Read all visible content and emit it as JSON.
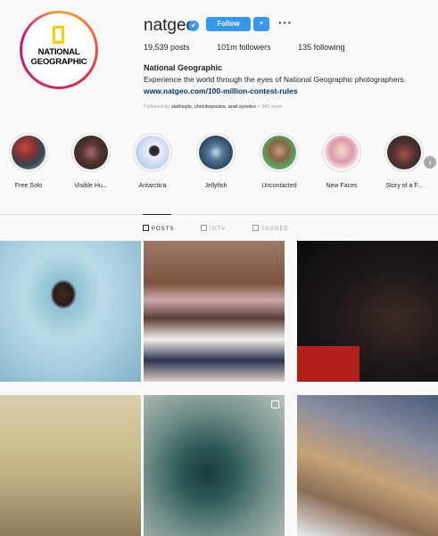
{
  "profile": {
    "logo_text_line1": "NATIONAL",
    "logo_text_line2": "GEOGRAPHIC",
    "username": "natgeo",
    "verified_glyph": "✔",
    "follow_label": "Follow",
    "dropdown_glyph": "▾",
    "more_glyph": "···",
    "stats": {
      "posts": "19,539 posts",
      "followers": "101m followers",
      "following": "135 following"
    },
    "full_name": "National Geographic",
    "bio": "Experience the world through the eyes of National Geographic photographers.",
    "link": "www.natgeo.com/100-million-contest-rules",
    "followed_by_prefix": "Followed by ",
    "followed_by_names": "stathispls, chricikopoulos, andr.synetos",
    "followed_by_more": " + 341 more"
  },
  "highlights": [
    {
      "label": "Free Solo"
    },
    {
      "label": "Visible Hu..."
    },
    {
      "label": "Antarctica"
    },
    {
      "label": "Jellyfish"
    },
    {
      "label": "Uncontacted"
    },
    {
      "label": "New Faces"
    },
    {
      "label": "Story of a F..."
    }
  ],
  "next_glyph": "›",
  "tabs": {
    "posts": "POSTS",
    "igtv": "IGTV",
    "tagged": "TAGGED"
  }
}
